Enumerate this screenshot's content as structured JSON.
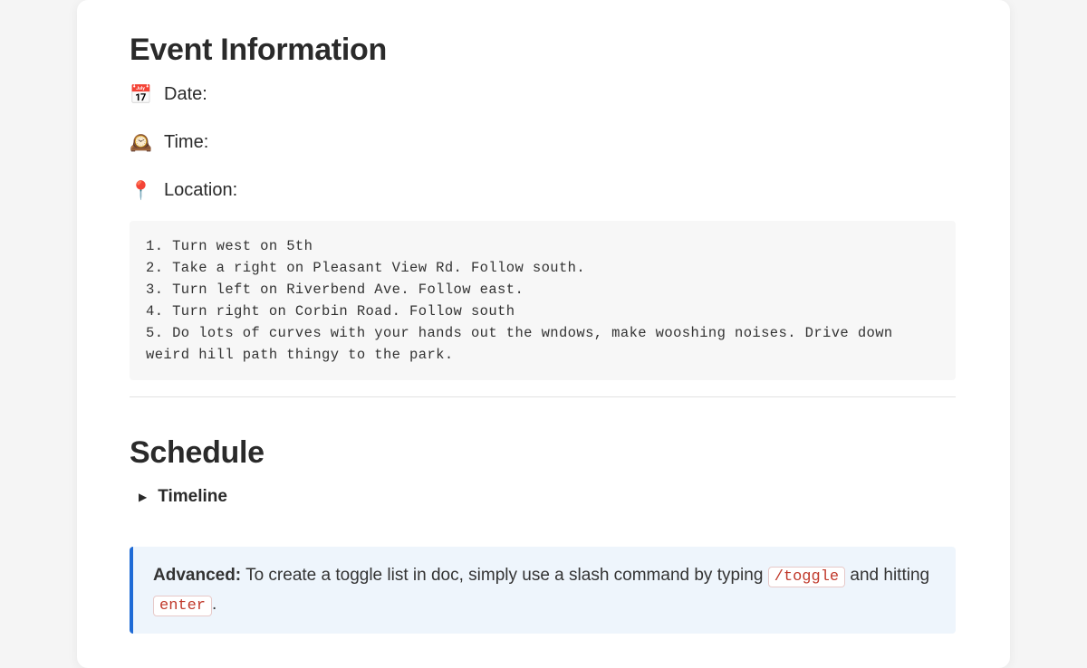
{
  "sections": {
    "event_info": {
      "title": "Event Information",
      "rows": [
        {
          "icon": "📅",
          "label": "Date:"
        },
        {
          "icon": "🕰️",
          "label": "Time:"
        },
        {
          "icon": "📍",
          "label": "Location:"
        }
      ]
    },
    "directions_code": "1. Turn west on 5th\n2. Take a right on Pleasant View Rd. Follow south.\n3. Turn left on Riverbend Ave. Follow east.\n4. Turn right on Corbin Road. Follow south\n5. Do lots of curves with your hands out the wndows, make wooshing noises. Drive down weird hill path thingy to the park.",
    "schedule": {
      "title": "Schedule",
      "toggle_label": "Timeline"
    },
    "callout": {
      "strong": "Advanced:",
      "text_before": " To create a toggle list in doc, simply use a slash command by typing ",
      "code1": "/toggle",
      "text_mid": " and hitting ",
      "code2": "enter",
      "text_after": "."
    }
  }
}
